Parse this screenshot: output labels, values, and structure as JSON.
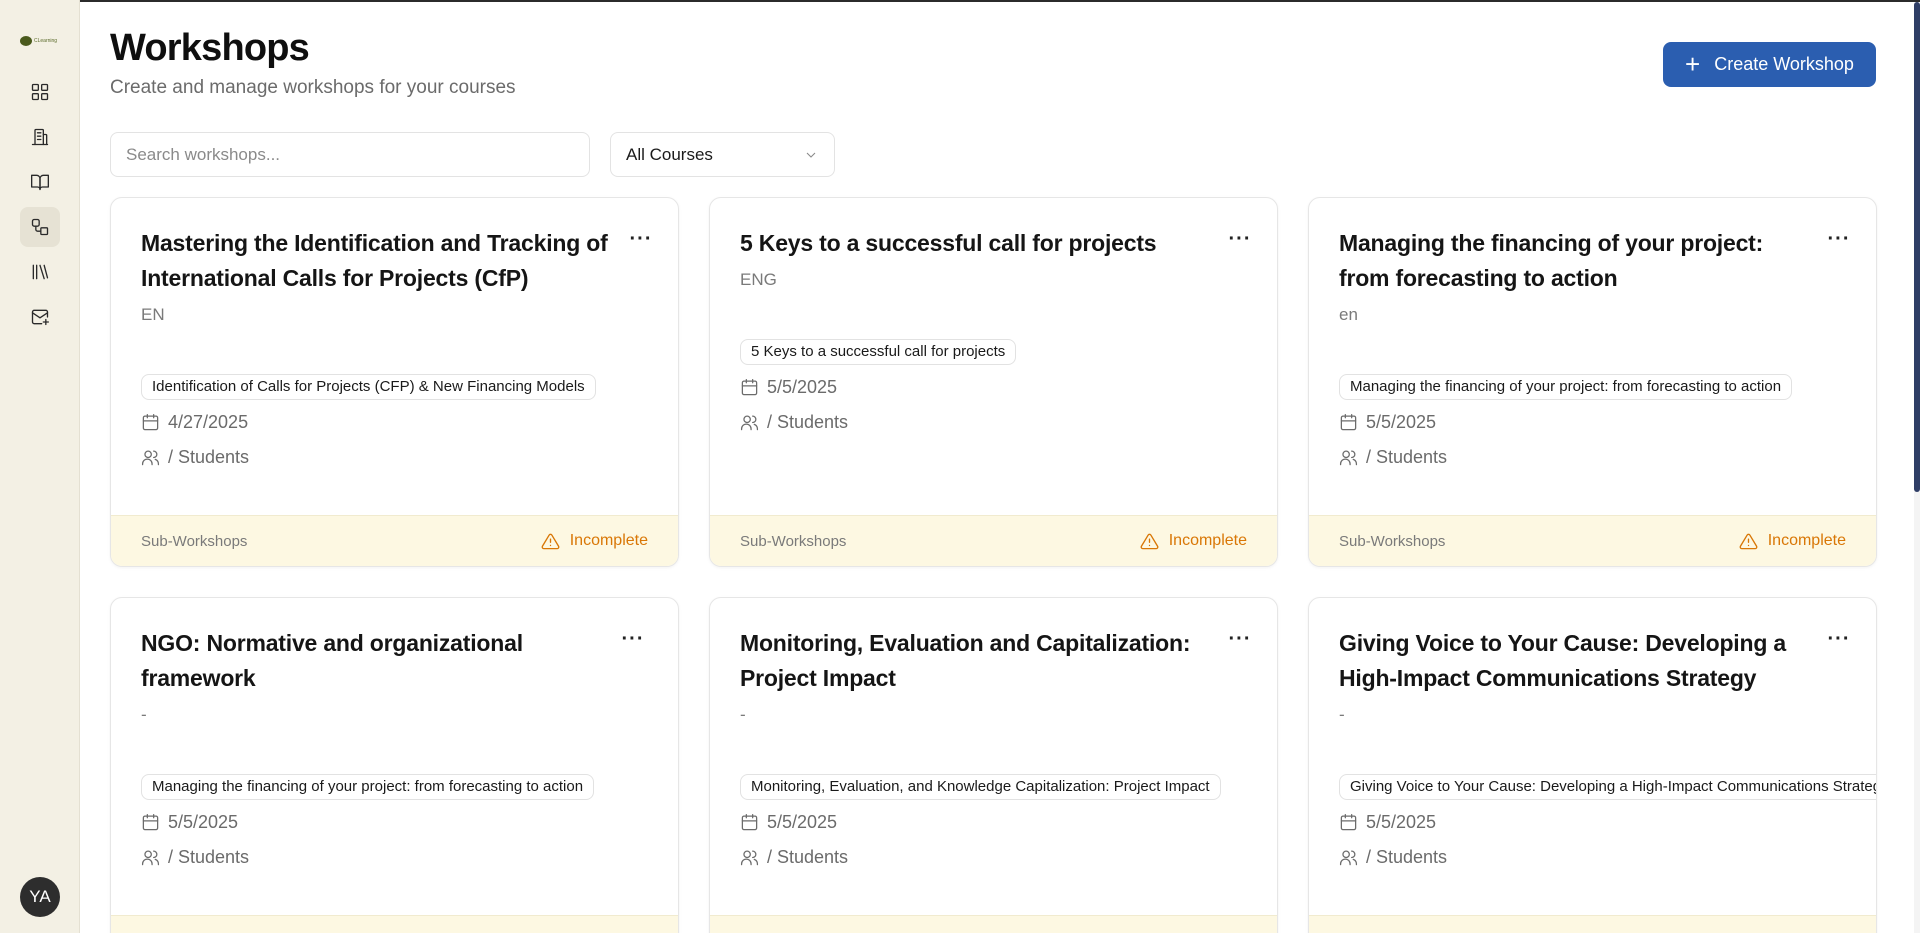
{
  "sidebar": {
    "logo_text": "CLearning",
    "items": [
      {
        "icon": "dashboard-grid-icon"
      },
      {
        "icon": "building-icon"
      },
      {
        "icon": "book-open-icon"
      },
      {
        "icon": "workshops-shapes-icon"
      },
      {
        "icon": "library-icon"
      },
      {
        "icon": "mail-plus-icon"
      }
    ],
    "avatar_initials": "YA"
  },
  "header": {
    "title": "Workshops",
    "subtitle": "Create and manage workshops for your courses",
    "create_button_icon": "+",
    "create_button_label": "Create Workshop"
  },
  "filters": {
    "search_placeholder": "Search workshops...",
    "course_select_value": "All Courses"
  },
  "cards": [
    {
      "title": "Mastering the Identification and Tracking of International Calls for Projects (CfP)",
      "language": "EN",
      "tag": "Identification of Calls for Projects (CFP) & New Financing Models",
      "date": "4/27/2025",
      "students": "/ Students",
      "footer_label": "Sub-Workshops",
      "status": "Incomplete",
      "menu": "···"
    },
    {
      "title": "5 Keys to a successful call for projects",
      "language": "ENG",
      "tag": "5 Keys to a successful call for projects",
      "date": "5/5/2025",
      "students": "/ Students",
      "footer_label": "Sub-Workshops",
      "status": "Incomplete",
      "menu": "···"
    },
    {
      "title": "Managing the financing of your project: from forecasting to action",
      "language": "en",
      "tag": "Managing the financing of your project: from forecasting to action",
      "date": "5/5/2025",
      "students": "/ Students",
      "footer_label": "Sub-Workshops",
      "status": "Incomplete",
      "menu": "···"
    },
    {
      "title": "NGO: Normative and organizational framework",
      "language": "-",
      "tag": "Managing the financing of your project: from forecasting to action",
      "date": "5/5/2025",
      "students": "/ Students",
      "menu": "···"
    },
    {
      "title": "Monitoring, Evaluation and Capitalization: Project Impact",
      "language": "-",
      "tag": "Monitoring, Evaluation, and Knowledge Capitalization: Project Impact",
      "date": "5/5/2025",
      "students": "/ Students",
      "menu": "···"
    },
    {
      "title": "Giving Voice to Your Cause: Developing a High-Impact Communications Strategy",
      "language": "-",
      "tag": "Giving Voice to Your Cause: Developing a High-Impact Communications Strategy",
      "date": "5/5/2025",
      "students": "/ Students",
      "menu": "···"
    }
  ],
  "colors": {
    "accent": "#2b5eb0",
    "sidebar_bg": "#f3f0e4",
    "footer_bg": "#fdf8e2",
    "warning": "#d97706"
  }
}
